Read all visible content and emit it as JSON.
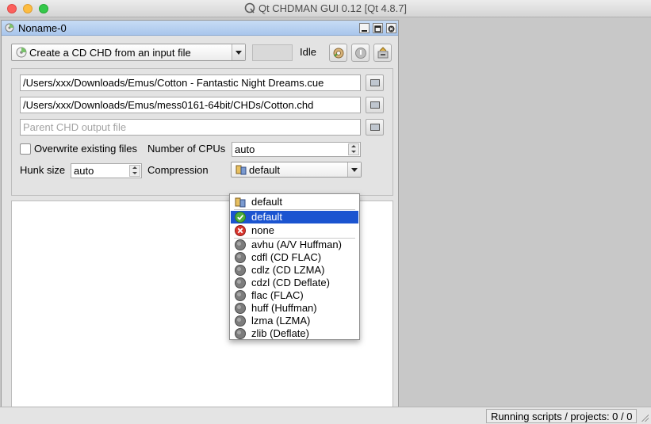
{
  "window": {
    "title": "Qt CHDMAN GUI 0.12 [Qt 4.8.7]"
  },
  "subwindow": {
    "title": "Noname-0"
  },
  "toolbar": {
    "mode_combo": "Create a CD CHD from an input file",
    "status": "Idle"
  },
  "form": {
    "input_file": "/Users/xxx/Downloads/Emus/Cotton - Fantastic Night Dreams.cue",
    "output_file": "/Users/xxx/Downloads/Emus/mess0161-64bit/CHDs/Cotton.chd",
    "parent_placeholder": "Parent CHD output file",
    "overwrite_label": "Overwrite existing files",
    "cpus_label": "Number of CPUs",
    "cpus_value": "auto",
    "hunk_label": "Hunk size",
    "hunk_value": "auto",
    "compression_label": "Compression",
    "compression_value": "default"
  },
  "compression_options": [
    {
      "label": "default",
      "icon": "multi-codec-icon"
    },
    {
      "label": "default",
      "icon": "check-icon",
      "selected": true
    },
    {
      "label": "none",
      "icon": "no-entry-icon"
    },
    {
      "label": "avhu (A/V Huffman)",
      "icon": "codec-disc-icon"
    },
    {
      "label": "cdfl (CD FLAC)",
      "icon": "codec-disc-icon"
    },
    {
      "label": "cdlz (CD LZMA)",
      "icon": "codec-disc-icon"
    },
    {
      "label": "cdzl (CD Deflate)",
      "icon": "codec-disc-icon"
    },
    {
      "label": "flac (FLAC)",
      "icon": "codec-disc-icon"
    },
    {
      "label": "huff (Huffman)",
      "icon": "codec-disc-icon"
    },
    {
      "label": "lzma (LZMA)",
      "icon": "codec-disc-icon"
    },
    {
      "label": "zlib (Deflate)",
      "icon": "codec-disc-icon"
    }
  ],
  "statusbar": {
    "text": "Running scripts / projects: 0 / 0"
  },
  "colors": {
    "selection": "#1b54d0",
    "titlebar_active": "#a9c6ec"
  }
}
